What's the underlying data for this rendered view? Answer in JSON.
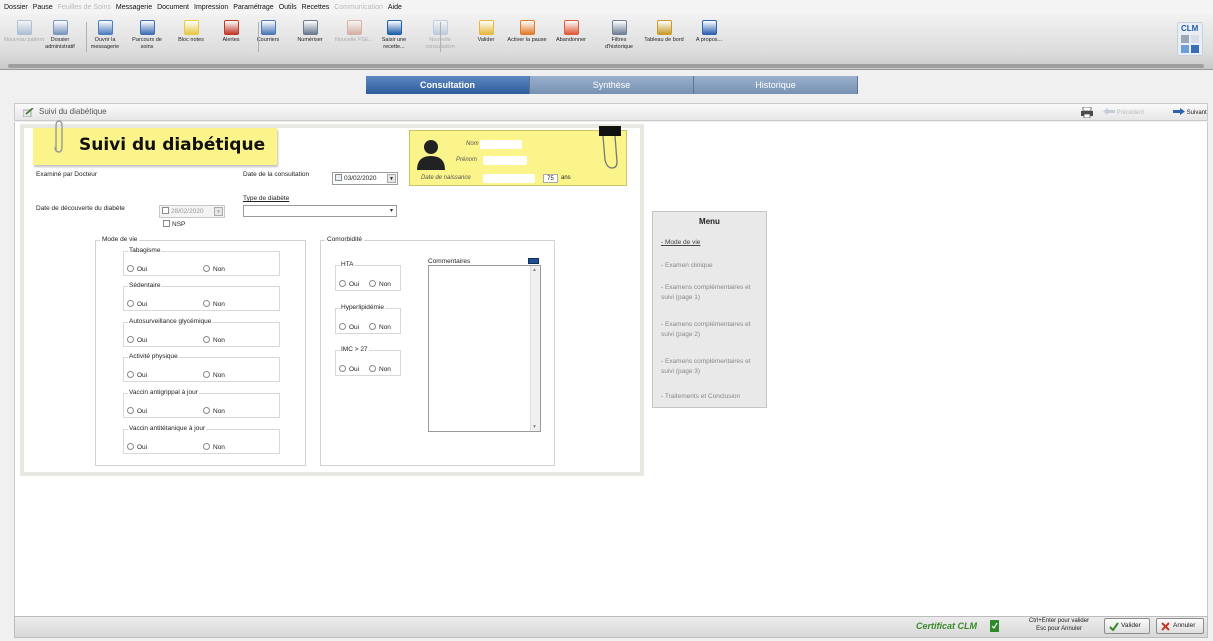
{
  "menubar": {
    "items": [
      {
        "label": "Dossier",
        "enabled": true
      },
      {
        "label": "Pause",
        "enabled": true
      },
      {
        "label": "Feuilles de Soins",
        "enabled": false
      },
      {
        "label": "Messagerie",
        "enabled": true
      },
      {
        "label": "Document",
        "enabled": true
      },
      {
        "label": "Impression",
        "enabled": true
      },
      {
        "label": "Paramétrage",
        "enabled": true
      },
      {
        "label": "Outils",
        "enabled": true
      },
      {
        "label": "Recettes",
        "enabled": true
      },
      {
        "label": "Communication",
        "enabled": false
      },
      {
        "label": "Aide",
        "enabled": true
      }
    ]
  },
  "toolbar": {
    "buttons": [
      {
        "label": "Nouveau patient",
        "icon": "new-patient-icon",
        "enabled": false,
        "color": "#6a8fc0"
      },
      {
        "label": "Dossier administratif",
        "icon": "admin-file-icon",
        "enabled": true,
        "color": "#7b96bf"
      },
      {
        "label": "Ouvrir la messagerie",
        "icon": "mail-icon",
        "enabled": true,
        "color": "#4d7fc0"
      },
      {
        "label": "Parcours de soins",
        "icon": "care-path-icon",
        "enabled": true,
        "color": "#3f6fb5"
      },
      {
        "label": "Bloc notes",
        "icon": "notepad-icon",
        "enabled": true,
        "color": "#e8c845"
      },
      {
        "label": "Alertes",
        "icon": "alert-icon",
        "enabled": true,
        "color": "#c0392b"
      },
      {
        "label": "Courriers",
        "icon": "letters-icon",
        "enabled": true,
        "color": "#4a78b8"
      },
      {
        "label": "Numériser",
        "icon": "scanner-icon",
        "enabled": true,
        "color": "#6b7a90"
      },
      {
        "label": "Nouvelle FSE...",
        "icon": "fse-icon",
        "enabled": false,
        "color": "#c07050"
      },
      {
        "label": "Saisir une recette...",
        "icon": "euro-icon",
        "enabled": true,
        "color": "#1f5fa8"
      },
      {
        "label": "Nouvelle consultation",
        "icon": "new-consult-icon",
        "enabled": false,
        "color": "#8aa9d6"
      },
      {
        "label": "Valider",
        "icon": "validate-icon",
        "enabled": true,
        "color": "#e6b93a"
      },
      {
        "label": "Activer la pause",
        "icon": "pause-icon",
        "enabled": true,
        "color": "#e07a2a"
      },
      {
        "label": "Abandonner",
        "icon": "abandon-icon",
        "enabled": true,
        "color": "#e05a3a"
      },
      {
        "label": "Filtres d'historique",
        "icon": "filter-icon",
        "enabled": true,
        "color": "#6e7f96"
      },
      {
        "label": "Tableau de bord",
        "icon": "dashboard-icon",
        "enabled": true,
        "color": "#c89a2a"
      },
      {
        "label": "A propos...",
        "icon": "help-icon",
        "enabled": true,
        "color": "#2d63b0"
      }
    ],
    "logo_text": "CLM"
  },
  "tabs": [
    {
      "label": "Consultation",
      "active": true
    },
    {
      "label": "Synthèse",
      "active": false
    },
    {
      "label": "Historique",
      "active": false
    }
  ],
  "titlebar": {
    "title": "Suivi du diabétique",
    "prev_label": "Précédent",
    "next_label": "Suivant"
  },
  "form": {
    "title": "Suivi du diabétique",
    "patient": {
      "nom_label": "Nom",
      "prenom_label": "Prénom",
      "naissance_label": "Date de naissance",
      "age": "75",
      "age_unit": "ans"
    },
    "examine_par_label": "Examiné par Docteur",
    "date_consultation_label": "Date de la consultation",
    "date_consultation_value": "03/02/2020",
    "date_decouverte_label": "Date de découverte du diabète",
    "date_decouverte_value": "28/02/2020",
    "nsp_label": "NSP",
    "type_diabete_label": "Type de diabète",
    "type_diabete_value": "",
    "radio_yes": "Oui",
    "radio_no": "Non",
    "mode_de_vie": {
      "label": "Mode de vie",
      "groups": [
        "Tabagisme",
        "Sédentaire",
        "Autosurveillance glycémique",
        "Activité physique",
        "Vaccin antigrippal à jour",
        "Vaccin antitétanique à jour"
      ]
    },
    "comorbidite": {
      "label": "Comorbidité",
      "groups": [
        "HTA",
        "Hyperlipidémie",
        "IMC > 27"
      ]
    },
    "commentaires_label": "Commentaires",
    "commentaires_value": ""
  },
  "side_menu": {
    "title": "Menu",
    "items": [
      {
        "label": "- Mode de vie",
        "current": true
      },
      {
        "label": "- Examen clinique",
        "current": false
      },
      {
        "label": "- Examens complémentaires et suivi (page 1)",
        "current": false
      },
      {
        "label": "- Examens complémentaires et suivi (page 2)",
        "current": false
      },
      {
        "label": "- Examens complémentaires et suivi (page 3)",
        "current": false
      },
      {
        "label": "- Traitements et Conclusion",
        "current": false
      }
    ]
  },
  "statusbar": {
    "certificat": "Certificat CLM",
    "hint_line1": "Ctrl+Enter pour valider",
    "hint_line2": "Esc pour Annuler",
    "validate_label": "Valider",
    "cancel_label": "Annuler"
  }
}
